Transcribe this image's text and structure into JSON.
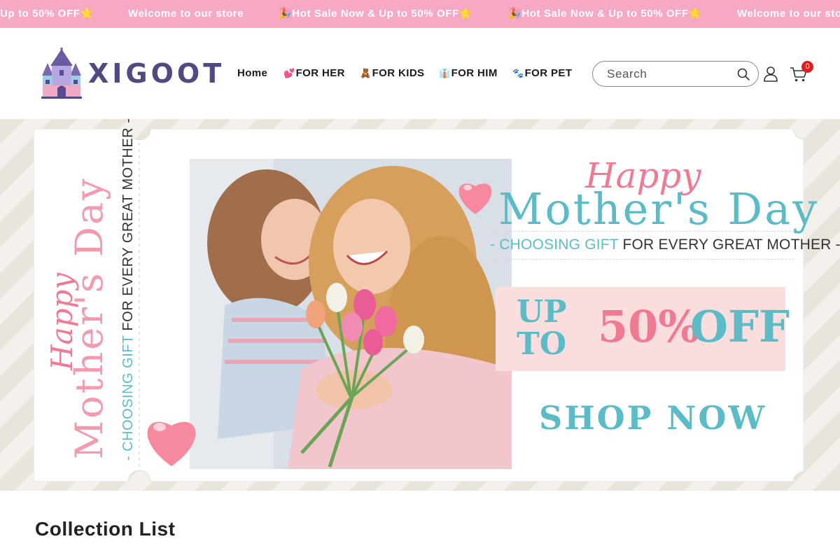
{
  "announcement": {
    "messages": [
      "Up to 50% OFF🌟",
      "Welcome to our store",
      "🎉Hot Sale Now & Up to 50% OFF🌟",
      "🎉Hot Sale Now & Up to 50% OFF🌟",
      "Welcome to our store"
    ]
  },
  "header": {
    "logo_text": "XIGOOT",
    "nav": [
      {
        "emoji": "",
        "label": "Home"
      },
      {
        "emoji": "💕",
        "label": "FOR HER"
      },
      {
        "emoji": "🧸",
        "label": "FOR KIDS"
      },
      {
        "emoji": "👔",
        "label": "FOR HIM"
      },
      {
        "emoji": "🐾",
        "label": "FOR PET"
      }
    ],
    "search_placeholder": "Search",
    "cart_count": "0"
  },
  "banner": {
    "left_script": "Happy",
    "left_title": "Mother's Day",
    "left_subtitle_a": "- CHOOSING GIFT",
    "left_subtitle_b": "FOR EVERY GREAT MOTHER -",
    "right_script": "Happy",
    "right_title": "Mother's Day",
    "right_subtitle_a": "- CHOOSING GIFT",
    "right_subtitle_b": " FOR EVERY GREAT MOTHER -",
    "offer_up": "UP",
    "offer_to": "TO",
    "offer_percent": "50%",
    "offer_off": "OFF",
    "shop_now": "SHOP NOW"
  },
  "section": {
    "title": "Collection List"
  },
  "colors": {
    "announce_bg": "#f7a8c4",
    "brand": "#4f4a82",
    "teal": "#5bbcc7",
    "pink": "#f07a94"
  }
}
